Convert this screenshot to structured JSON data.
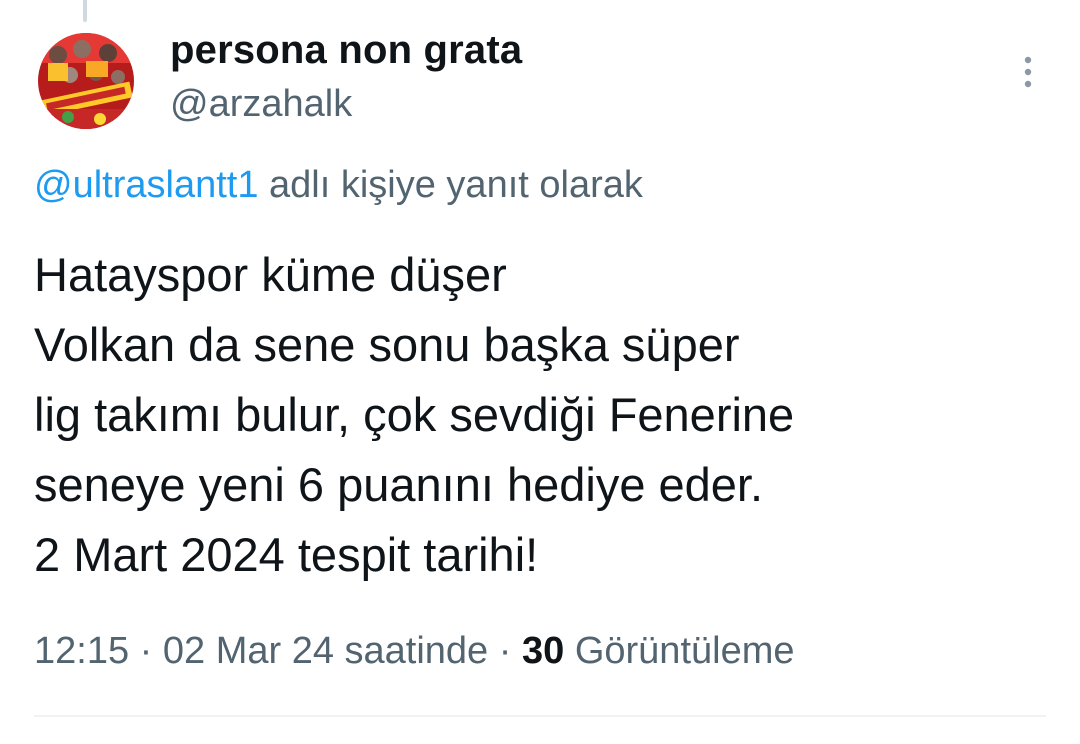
{
  "tweet": {
    "author": {
      "display_name": "persona non grata",
      "handle": "@arzahalk",
      "avatar_icon": "team-celebration-avatar"
    },
    "more_icon": "vertical-ellipsis-icon",
    "reply_context": {
      "mention": "@ultraslantt1",
      "suffix": "adlı kişiye yanıt olarak"
    },
    "body_lines": [
      "Hatayspor küme düşer",
      "Volkan da sene sonu başka süper",
      "lig takımı bulur, çok sevdiği Fenerine",
      "seneye yeni 6 puanını hediye eder.",
      "2 Mart 2024 tespit tarihi!"
    ],
    "meta": {
      "time": "12:15",
      "separator": "·",
      "date": "02 Mar 24 saatinde",
      "views_count": "30",
      "views_label": "Görüntüleme"
    }
  },
  "colors": {
    "text_primary": "#0f1419",
    "text_secondary": "#536471",
    "link": "#1d9bf0",
    "divider": "#eff3f4"
  }
}
